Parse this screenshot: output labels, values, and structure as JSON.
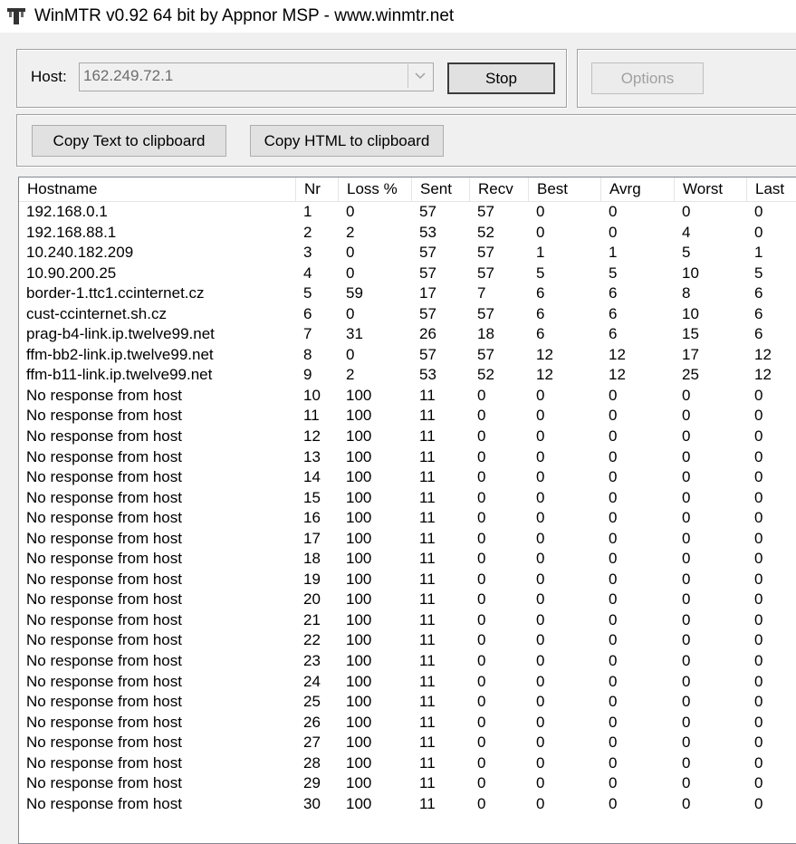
{
  "window": {
    "title": "WinMTR v0.92 64 bit by Appnor MSP - www.winmtr.net"
  },
  "host": {
    "label": "Host:",
    "value": "162.249.72.1",
    "stop_label": "Stop",
    "options_label": "Options"
  },
  "copy": {
    "text_label": "Copy Text to clipboard",
    "html_label": "Copy HTML to clipboard"
  },
  "table": {
    "columns": [
      "Hostname",
      "Nr",
      "Loss %",
      "Sent",
      "Recv",
      "Best",
      "Avrg",
      "Worst",
      "Last"
    ],
    "rows": [
      [
        "192.168.0.1",
        "1",
        "0",
        "57",
        "57",
        "0",
        "0",
        "0",
        "0"
      ],
      [
        "192.168.88.1",
        "2",
        "2",
        "53",
        "52",
        "0",
        "0",
        "4",
        "0"
      ],
      [
        "10.240.182.209",
        "3",
        "0",
        "57",
        "57",
        "1",
        "1",
        "5",
        "1"
      ],
      [
        "10.90.200.25",
        "4",
        "0",
        "57",
        "57",
        "5",
        "5",
        "10",
        "5"
      ],
      [
        "border-1.ttc1.ccinternet.cz",
        "5",
        "59",
        "17",
        "7",
        "6",
        "6",
        "8",
        "6"
      ],
      [
        "cust-ccinternet.sh.cz",
        "6",
        "0",
        "57",
        "57",
        "6",
        "6",
        "10",
        "6"
      ],
      [
        "prag-b4-link.ip.twelve99.net",
        "7",
        "31",
        "26",
        "18",
        "6",
        "6",
        "15",
        "6"
      ],
      [
        "ffm-bb2-link.ip.twelve99.net",
        "8",
        "0",
        "57",
        "57",
        "12",
        "12",
        "17",
        "12"
      ],
      [
        "ffm-b11-link.ip.twelve99.net",
        "9",
        "2",
        "53",
        "52",
        "12",
        "12",
        "25",
        "12"
      ],
      [
        "No response from host",
        "10",
        "100",
        "11",
        "0",
        "0",
        "0",
        "0",
        "0"
      ],
      [
        "No response from host",
        "11",
        "100",
        "11",
        "0",
        "0",
        "0",
        "0",
        "0"
      ],
      [
        "No response from host",
        "12",
        "100",
        "11",
        "0",
        "0",
        "0",
        "0",
        "0"
      ],
      [
        "No response from host",
        "13",
        "100",
        "11",
        "0",
        "0",
        "0",
        "0",
        "0"
      ],
      [
        "No response from host",
        "14",
        "100",
        "11",
        "0",
        "0",
        "0",
        "0",
        "0"
      ],
      [
        "No response from host",
        "15",
        "100",
        "11",
        "0",
        "0",
        "0",
        "0",
        "0"
      ],
      [
        "No response from host",
        "16",
        "100",
        "11",
        "0",
        "0",
        "0",
        "0",
        "0"
      ],
      [
        "No response from host",
        "17",
        "100",
        "11",
        "0",
        "0",
        "0",
        "0",
        "0"
      ],
      [
        "No response from host",
        "18",
        "100",
        "11",
        "0",
        "0",
        "0",
        "0",
        "0"
      ],
      [
        "No response from host",
        "19",
        "100",
        "11",
        "0",
        "0",
        "0",
        "0",
        "0"
      ],
      [
        "No response from host",
        "20",
        "100",
        "11",
        "0",
        "0",
        "0",
        "0",
        "0"
      ],
      [
        "No response from host",
        "21",
        "100",
        "11",
        "0",
        "0",
        "0",
        "0",
        "0"
      ],
      [
        "No response from host",
        "22",
        "100",
        "11",
        "0",
        "0",
        "0",
        "0",
        "0"
      ],
      [
        "No response from host",
        "23",
        "100",
        "11",
        "0",
        "0",
        "0",
        "0",
        "0"
      ],
      [
        "No response from host",
        "24",
        "100",
        "11",
        "0",
        "0",
        "0",
        "0",
        "0"
      ],
      [
        "No response from host",
        "25",
        "100",
        "11",
        "0",
        "0",
        "0",
        "0",
        "0"
      ],
      [
        "No response from host",
        "26",
        "100",
        "11",
        "0",
        "0",
        "0",
        "0",
        "0"
      ],
      [
        "No response from host",
        "27",
        "100",
        "11",
        "0",
        "0",
        "0",
        "0",
        "0"
      ],
      [
        "No response from host",
        "28",
        "100",
        "11",
        "0",
        "0",
        "0",
        "0",
        "0"
      ],
      [
        "No response from host",
        "29",
        "100",
        "11",
        "0",
        "0",
        "0",
        "0",
        "0"
      ],
      [
        "No response from host",
        "30",
        "100",
        "11",
        "0",
        "0",
        "0",
        "0",
        "0"
      ]
    ]
  }
}
